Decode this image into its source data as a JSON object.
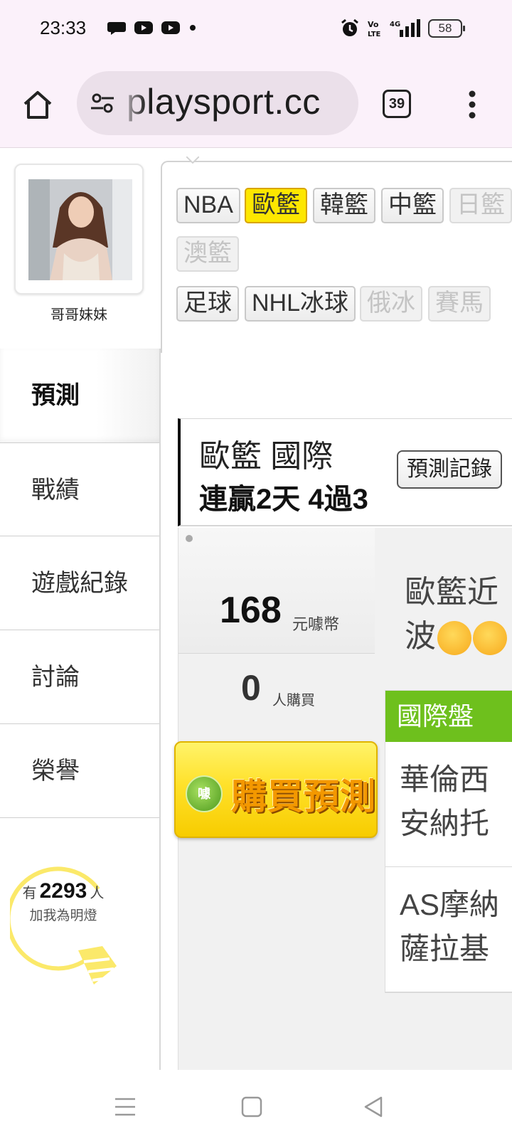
{
  "status_bar": {
    "time": "23:33",
    "left_icons": [
      "chat-bubble-icon",
      "youtube-icon",
      "youtube-icon",
      "dot-icon"
    ],
    "right_icons": [
      "alarm-icon",
      "volte-icon",
      "signal-4g-icon"
    ],
    "battery": "58"
  },
  "browser": {
    "url": "playsport.cc",
    "tab_count": "39",
    "icons": [
      "home-icon",
      "site-settings-icon",
      "more-vert-icon"
    ]
  },
  "profile": {
    "username": "哥哥妹妹"
  },
  "sidebar": {
    "items": [
      {
        "label": "預測",
        "active": true
      },
      {
        "label": "戰績",
        "active": false
      },
      {
        "label": "遊戲紀錄",
        "active": false
      },
      {
        "label": "討論",
        "active": false
      },
      {
        "label": "榮譽",
        "active": false
      }
    ]
  },
  "lamp": {
    "prefix": "有",
    "count": "2293",
    "suffix": "人",
    "caption": "加我為明燈"
  },
  "categories": {
    "row1": [
      {
        "label": "NBA",
        "state": "normal"
      },
      {
        "label": "歐籃",
        "state": "active"
      },
      {
        "label": "韓籃",
        "state": "normal"
      },
      {
        "label": "中籃",
        "state": "normal"
      },
      {
        "label": "日籃",
        "state": "disabled"
      }
    ],
    "row2": [
      {
        "label": "澳籃",
        "state": "disabled"
      }
    ],
    "row3": [
      {
        "label": "足球",
        "state": "normal"
      },
      {
        "label": "NHL冰球",
        "state": "normal"
      },
      {
        "label": "俄冰",
        "state": "disabled"
      },
      {
        "label": "賽馬",
        "state": "disabled"
      }
    ]
  },
  "record": {
    "league": "歐籃 國際",
    "streak": "連贏2天 4過3",
    "history_button": "預測記錄"
  },
  "purchase": {
    "price": "168",
    "price_unit": "元噱幣",
    "buyers": "0",
    "buyers_unit": "人購買",
    "badge": "噱",
    "button_label": "購買預測"
  },
  "analysis": {
    "line1": "歐籃近",
    "line2": "波"
  },
  "intl_table": {
    "header": "國際盤",
    "matches": [
      {
        "team1": "華倫西",
        "team2": "安納托"
      },
      {
        "team1": "AS摩納",
        "team2": "薩拉基"
      }
    ]
  },
  "colors": {
    "accent_green": "#6ec01d",
    "active_chip": "#fde700",
    "buy_button": "#ffe12a",
    "lamp_yellow": "#fbe96a"
  }
}
